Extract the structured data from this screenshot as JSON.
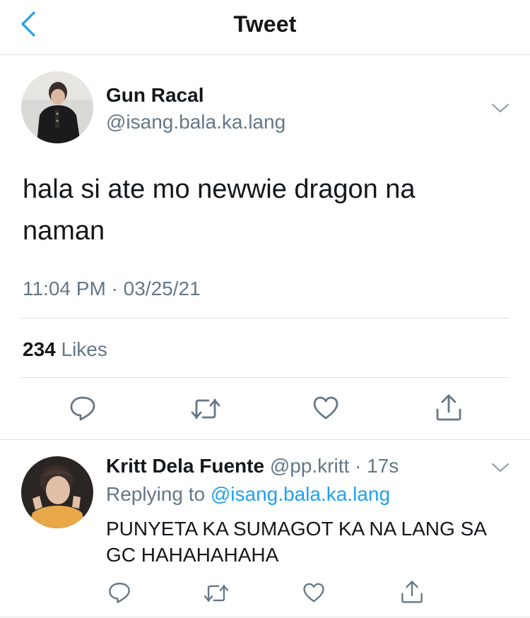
{
  "header": {
    "title": "Tweet",
    "back_icon": "chevron-left-icon",
    "accent": "#1da1f2"
  },
  "tweet": {
    "author_name": "Gun Racal",
    "author_handle": "@isang.bala.ka.lang",
    "text": "hala si ate mo newwie dragon na naman",
    "timestamp": "11:04 PM · 03/25/21",
    "likes_count": "234",
    "likes_label": "Likes",
    "actions": [
      "reply-icon",
      "retweet-icon",
      "like-icon",
      "share-icon"
    ]
  },
  "reply": {
    "author_name": "Kritt Dela Fuente",
    "author_handle": "@pp.kritt",
    "time": "· 17s",
    "replying_prefix": "Replying to",
    "replying_to": "@isang.bala.ka.lang",
    "text": "PUNYETA KA SUMAGOT KA NA LANG SA GC HAHAHAHAHA",
    "actions": [
      "reply-icon",
      "retweet-icon",
      "like-icon",
      "share-icon"
    ]
  },
  "colors": {
    "text": "#14171a",
    "secondary": "#657786",
    "link": "#1da1f2",
    "divider": "#d8dde1"
  }
}
